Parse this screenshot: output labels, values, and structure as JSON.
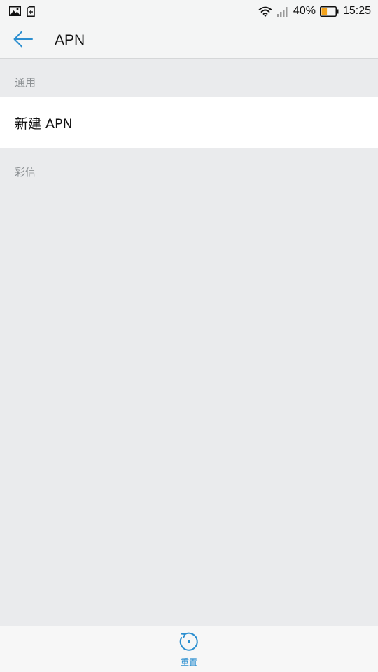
{
  "status_bar": {
    "battery_percent": "40%",
    "time": "15:25",
    "battery_level": 0.4,
    "icons": [
      "image-icon",
      "sim-card-icon",
      "wifi-icon",
      "signal-icon",
      "battery-icon"
    ]
  },
  "header": {
    "title": "APN",
    "back_icon": "back-arrow-icon"
  },
  "sections": {
    "general_label": "通用",
    "new_apn_label": "新建 APN",
    "mms_label": "彩信"
  },
  "bottom_bar": {
    "reset_label": "重置",
    "reset_icon": "reset-icon"
  },
  "colors": {
    "accent": "#2c8fd0",
    "background": "#eaebed",
    "header_bg": "#f4f5f5",
    "row_bg": "#ffffff",
    "section_label": "#8d9194"
  }
}
